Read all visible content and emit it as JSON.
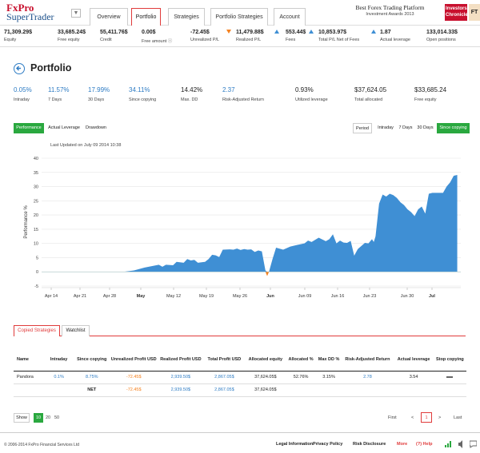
{
  "brand": {
    "line1": "FxPro",
    "line2": "SuperTrader",
    "dropdown_glyph": "▼"
  },
  "nav": {
    "tabs": [
      {
        "label": "Overview"
      },
      {
        "label": "Portfolio"
      },
      {
        "label": "Strategies"
      },
      {
        "label": "Portfolio Strategies"
      },
      {
        "label": "Account"
      }
    ]
  },
  "award": {
    "title": "Best Forex Trading Platform",
    "subtitle": "Investment Awards 2013",
    "investors_logo": "Investors Chronicle",
    "ft_logo": "FT"
  },
  "stats": [
    {
      "value": "71,309.29$",
      "label": "Equity"
    },
    {
      "value": "33,685.24$",
      "label": "Free equity"
    },
    {
      "value": "55,411.76$",
      "label": "Credit"
    },
    {
      "value": "0.00$",
      "label": "Free amount ⓘ"
    },
    {
      "value": "-72.45$",
      "label": "Unrealized P/L"
    },
    {
      "value": "11,479.88$",
      "label": "Realized P/L"
    },
    {
      "value": "553.44$",
      "label": "Fees"
    },
    {
      "value": "10,853.97$",
      "label": "Total P/L Net of Fees"
    },
    {
      "value": "1.87",
      "label": "Actual leverage"
    },
    {
      "value": "133,014.33$",
      "label": "Open positions"
    }
  ],
  "page": {
    "title": "Portfolio"
  },
  "kpis": [
    {
      "value": "0.05%",
      "label": "Intraday"
    },
    {
      "value": "11.57%",
      "label": "7 Days"
    },
    {
      "value": "17.99%",
      "label": "30 Days"
    },
    {
      "value": "34.11%",
      "label": "Since copying"
    },
    {
      "value": "14.42%",
      "label": "Max. DD"
    },
    {
      "value": "2.37",
      "label": "Risk-Adjusted Return"
    },
    {
      "value": "0.93%",
      "label": "Utilized leverage"
    },
    {
      "value": "$37,624.05",
      "label": "Total allocated"
    },
    {
      "value": "$33,685.24",
      "label": "Free equity"
    }
  ],
  "chart_controls": {
    "views": [
      "Performance",
      "Actual Leverage",
      "Drawdown"
    ],
    "period_label": "Period",
    "periods": [
      "Intraday",
      "7 Days",
      "30 Days",
      "Since copying"
    ],
    "last_updated": "Last Updated on July 09 2014 10:38"
  },
  "chart_data": {
    "type": "area",
    "title": "",
    "xlabel": "",
    "ylabel": "Performance %",
    "ylim": [
      -5,
      40
    ],
    "yticks": [
      -5,
      0,
      5,
      10,
      15,
      20,
      25,
      30,
      35,
      40
    ],
    "grid": true,
    "color": "#3f8fd4",
    "negative_color": "#f58220",
    "xtick_labels": [
      {
        "x": 10,
        "label": "Apr 14",
        "bold": false
      },
      {
        "x": 17,
        "label": "Apr 21",
        "bold": false
      },
      {
        "x": 24,
        "label": "Apr 28",
        "bold": false
      },
      {
        "x": 27,
        "label": "May",
        "bold": true
      },
      {
        "x": 38,
        "label": "May 12",
        "bold": false
      },
      {
        "x": 45,
        "label": "May 19",
        "bold": false
      },
      {
        "x": 52,
        "label": "May 26",
        "bold": false
      },
      {
        "x": 58,
        "label": "Jun",
        "bold": true
      },
      {
        "x": 66,
        "label": "Jun 09",
        "bold": false
      },
      {
        "x": 73,
        "label": "Jun 16",
        "bold": false
      },
      {
        "x": 80,
        "label": "Jun 23",
        "bold": false
      },
      {
        "x": 87,
        "label": "Jun 30",
        "bold": false
      },
      {
        "x": 88,
        "label": "Jul",
        "bold": true
      }
    ],
    "x_domain": [
      4,
      93
    ],
    "points": [
      [
        4,
        0
      ],
      [
        27,
        0
      ],
      [
        30,
        0.5
      ],
      [
        33,
        1.5
      ],
      [
        37,
        2.5
      ],
      [
        38,
        1.8
      ],
      [
        39,
        2.5
      ],
      [
        41,
        2.3
      ],
      [
        42,
        3.5
      ],
      [
        44,
        3.2
      ],
      [
        45,
        4.5
      ],
      [
        46,
        4.0
      ],
      [
        47,
        4.2
      ],
      [
        48,
        3.2
      ],
      [
        50,
        3.5
      ],
      [
        51,
        4.5
      ],
      [
        52,
        6.0
      ],
      [
        53,
        5.8
      ],
      [
        54,
        5.2
      ],
      [
        55,
        7.8
      ],
      [
        57,
        7.9
      ],
      [
        58,
        7.8
      ],
      [
        59,
        8.2
      ],
      [
        60,
        7.7
      ],
      [
        61,
        8.0
      ],
      [
        62,
        7.8
      ],
      [
        63,
        7.9
      ],
      [
        64,
        7.0
      ],
      [
        65,
        7.5
      ],
      [
        66,
        7.2
      ],
      [
        67,
        0.5
      ],
      [
        67.5,
        -1.5
      ],
      [
        68,
        0
      ],
      [
        69,
        4.5
      ],
      [
        70,
        8.5
      ],
      [
        72,
        7.8
      ],
      [
        74,
        8.9
      ],
      [
        76,
        9.5
      ],
      [
        78,
        10.0
      ],
      [
        79,
        11.0
      ],
      [
        80,
        10.5
      ],
      [
        82,
        12.0
      ],
      [
        84,
        10.8
      ],
      [
        85,
        11.5
      ],
      [
        86,
        13.2
      ],
      [
        87,
        10.0
      ],
      [
        88,
        11.0
      ],
      [
        89,
        10.3
      ],
      [
        90,
        10.2
      ],
      [
        91,
        10.9
      ],
      [
        92,
        5.7
      ],
      [
        93,
        8.0
      ],
      [
        95,
        10.2
      ],
      [
        96,
        10.0
      ],
      [
        97,
        11.5
      ],
      [
        97.5,
        10.5
      ],
      [
        98,
        12.5
      ],
      [
        99,
        24.0
      ],
      [
        100,
        27.2
      ],
      [
        101,
        26.5
      ],
      [
        102,
        27.5
      ],
      [
        103,
        27.0
      ],
      [
        104,
        26.0
      ],
      [
        105,
        24.5
      ],
      [
        106,
        23.5
      ],
      [
        107,
        22.0
      ],
      [
        108,
        21.0
      ],
      [
        109,
        19.6
      ],
      [
        110,
        22.0
      ],
      [
        111,
        23.0
      ],
      [
        112,
        20.5
      ],
      [
        113,
        27.5
      ],
      [
        114,
        27.8
      ],
      [
        116,
        27.8
      ],
      [
        117,
        27.8
      ],
      [
        118,
        30.0
      ],
      [
        119,
        31.5
      ],
      [
        120,
        33.8
      ],
      [
        121,
        34.1
      ]
    ]
  },
  "copied": {
    "tabs": [
      "Copied Strategies",
      "Watchlist"
    ],
    "headers": [
      "Name",
      "Intraday",
      "Since copying",
      "Unrealized Profit USD",
      "Realized Profit USD",
      "Total Profit USD",
      "Allocated equity",
      "Allocated %",
      "Max DD %",
      "Risk-Adjusted Return",
      "Actual leverage",
      "Stop copying"
    ],
    "rows": [
      {
        "name": "Pandora",
        "intraday": "0.1%",
        "since": "8.75%",
        "unrealized": "-72.45$",
        "realized": "2,939.50$",
        "total": "2,867.05$",
        "alloc_eq": "37,624.05$",
        "alloc_pct": "52.76%",
        "maxdd": "3.15%",
        "rar": "2.78",
        "lev": "3.54",
        "stop": "stop-dash-icon"
      }
    ],
    "net": {
      "label": "NET",
      "unrealized": "-72.45$",
      "realized": "2,939.50$",
      "total": "2,867.05$",
      "alloc_eq": "37,624.05$"
    }
  },
  "pagination": {
    "show_label": "Show",
    "sizes": [
      "10",
      "20",
      "50"
    ],
    "first": "First",
    "prev": "<",
    "current": "1",
    "next": ">",
    "last": "Last"
  },
  "footer": {
    "copyright": "© 2006-2014 FxPro Financial Services Ltd",
    "links": [
      "Legal Information",
      "Privacy Policy",
      "Risk Disclosure",
      "More"
    ],
    "help": "(?) Help"
  },
  "colors": {
    "accent_red": "#e03b3b",
    "blue": "#2e7cc4",
    "orange": "#f58220",
    "green": "#2aa83f"
  }
}
